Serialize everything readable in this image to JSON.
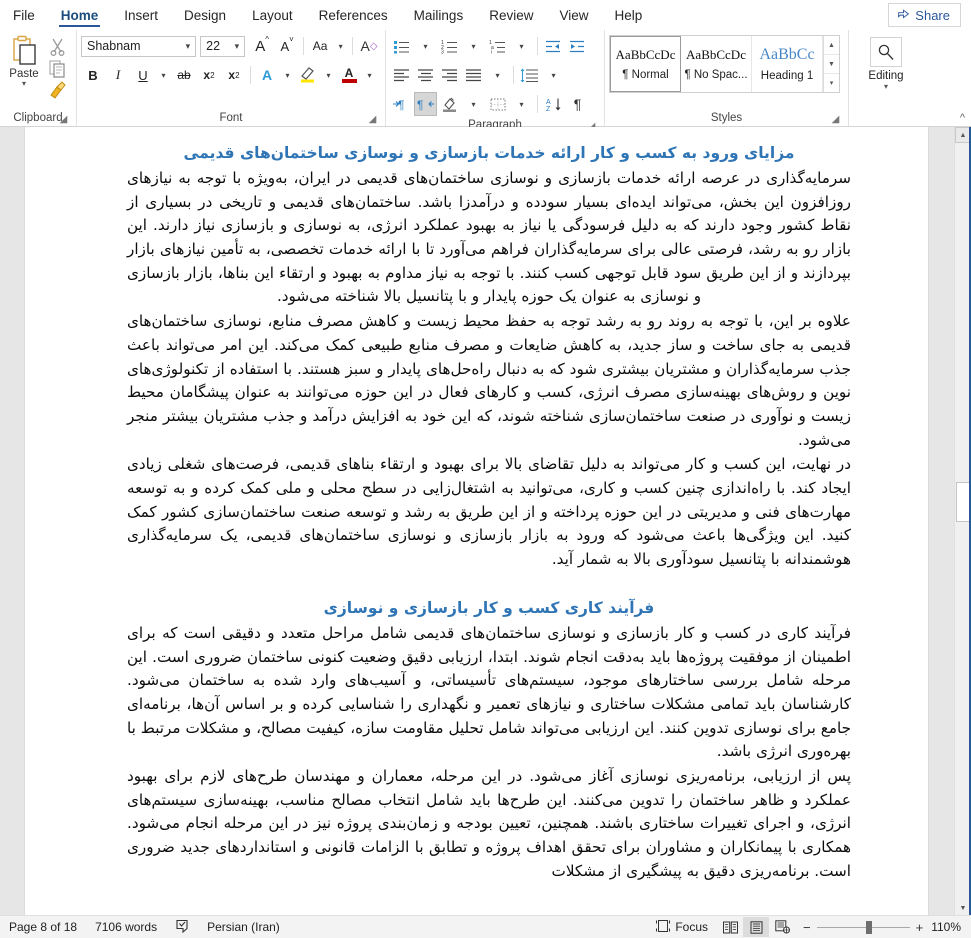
{
  "app": {
    "tabs": [
      {
        "label": "File",
        "active": false
      },
      {
        "label": "Home",
        "active": true
      },
      {
        "label": "Insert",
        "active": false
      },
      {
        "label": "Design",
        "active": false
      },
      {
        "label": "Layout",
        "active": false
      },
      {
        "label": "References",
        "active": false
      },
      {
        "label": "Mailings",
        "active": false
      },
      {
        "label": "Review",
        "active": false
      },
      {
        "label": "View",
        "active": false
      },
      {
        "label": "Help",
        "active": false
      }
    ],
    "share_label": "Share"
  },
  "ribbon": {
    "clipboard": {
      "group_label": "Clipboard",
      "paste_label": "Paste",
      "cut_name": "cut-icon",
      "copy_name": "copy-icon",
      "format_painter_name": "format-painter-icon"
    },
    "font": {
      "group_label": "Font",
      "font_name": "Shabnam",
      "font_size": "22",
      "grow_font": "A",
      "shrink_font": "A",
      "change_case": "Aa",
      "clear_formatting": "A",
      "bold": "B",
      "italic": "I",
      "underline": "U",
      "strikethrough": "ab",
      "subscript": "x",
      "superscript": "x",
      "text_effects": "A",
      "highlight": "A",
      "font_color": "A"
    },
    "paragraph": {
      "group_label": "Paragraph",
      "bullets": "bullets-icon",
      "numbering": "numbering-icon",
      "multilevel": "multilevel-list-icon",
      "decrease_indent": "decrease-indent-icon",
      "increase_indent": "increase-indent-icon",
      "align_left": "align-left-icon",
      "align_center": "align-center-icon",
      "align_right": "align-right-icon",
      "justify": "justify-icon",
      "line_spacing": "line-spacing-icon",
      "ltr": "left-to-right-icon",
      "rtl": "right-to-left-icon",
      "shading": "shading-icon",
      "borders": "borders-icon",
      "sort": "sort-icon",
      "show_marks": "show-formatting-marks-icon"
    },
    "styles": {
      "group_label": "Styles",
      "items": [
        {
          "preview": "AaBbCcDc",
          "name": "¶ Normal",
          "selected": true
        },
        {
          "preview": "AaBbCcDc",
          "name": "¶ No Spac...",
          "selected": false
        },
        {
          "preview": "AaBbCс",
          "name": "Heading 1",
          "selected": false
        }
      ]
    },
    "editing": {
      "group_label": "",
      "label": "Editing",
      "icon": "search-icon"
    }
  },
  "document": {
    "blocks": [
      {
        "type": "heading",
        "text": "مزایای ورود به کسب و کار ارائه خدمات بازسازی و نوسازی ساختمان‌های قدیمی"
      },
      {
        "type": "paragraph",
        "text": "سرمایه‌گذاری در عرصه ارائه خدمات بازسازی و نوسازی ساختمان‌های قدیمی در ایران، به‌ویژه با توجه به نیازهای روزافزون این بخش، می‌تواند ایده‌ای بسیار سودده و درآمدزا باشد. ساختمان‌های قدیمی و تاریخی در بسیاری از نقاط کشور وجود دارند که به دلیل فرسودگی یا نیاز به بهبود عملکرد انرژی، به نوسازی و بازسازی نیاز دارند. این بازار رو به رشد، فرصتی عالی برای سرمایه‌گذاران فراهم می‌آورد تا با ارائه خدمات تخصصی، به تأمین نیازهای بازار بپردازند و از این طریق سود قابل توجهی کسب کنند. با توجه به نیاز مداوم به بهبود و ارتقاء این بناها، بازار بازسازی و نوسازی به عنوان یک حوزه پایدار و با پتانسیل بالا شناخته می‌شود."
      },
      {
        "type": "paragraph",
        "text": "علاوه بر این، با توجه به روند رو به رشد توجه به حفظ محیط زیست و کاهش مصرف منابع، نوسازی ساختمان‌های قدیمی به جای ساخت و ساز جدید، به کاهش ضایعات و مصرف منابع طبیعی کمک می‌کند. این امر می‌تواند باعث جذب سرمایه‌گذاران و مشتریان بیشتری شود که به دنبال راه‌حل‌های پایدار و سبز هستند. با استفاده از تکنولوژی‌های نوین و روش‌های بهینه‌سازی مصرف انرژی، کسب و کارهای فعال در این حوزه می‌توانند به عنوان پیشگامان محیط زیست و نوآوری در صنعت ساختمان‌سازی شناخته شوند، که این خود به افزایش درآمد و جذب مشتریان بیشتر منجر می‌شود."
      },
      {
        "type": "paragraph",
        "text": "در نهایت، این کسب و کار می‌تواند به دلیل تقاضای بالا برای بهبود و ارتقاء بناهای قدیمی، فرصت‌های شغلی زیادی ایجاد کند. با راه‌اندازی چنین کسب و کاری، می‌توانید به اشتغال‌زایی در سطح محلی و ملی کمک کرده و به توسعه مهارت‌های فنی و مدیریتی در این حوزه پرداخته و از این طریق به رشد و توسعه صنعت ساختمان‌سازی کشور کمک کنید. این ویژگی‌ها باعث می‌شود که ورود به بازار بازسازی و نوسازی ساختمان‌های قدیمی، یک سرمایه‌گذاری هوشمندانه با پتانسیل سودآوری بالا به شمار آید."
      },
      {
        "type": "heading2",
        "text": "فرآیند کاری کسب و کار بازسازی و نوسازی"
      },
      {
        "type": "paragraph",
        "text": "فرآیند کاری در کسب و کار بازسازی و نوسازی ساختمان‌های قدیمی شامل مراحل متعدد و دقیقی است که برای اطمینان از موفقیت پروژه‌ها باید به‌دقت انجام شوند. ابتدا، ارزیابی دقیق وضعیت کنونی ساختمان ضروری است. این مرحله شامل بررسی ساختارهای موجود، سیستم‌های تأسیساتی، و آسیب‌های وارد شده به ساختمان می‌شود. کارشناسان باید تمامی مشکلات ساختاری و نیازهای تعمیر و نگهداری را شناسایی کرده و بر اساس آن‌ها، برنامه‌ای جامع برای نوسازی تدوین کنند. این ارزیابی می‌تواند شامل تحلیل مقاومت سازه، کیفیت مصالح، و مشکلات مرتبط با بهره‌وری انرژی باشد."
      },
      {
        "type": "paragraph",
        "text": "پس از ارزیابی، برنامه‌ریزی نوسازی آغاز می‌شود. در این مرحله، معماران و مهندسان طرح‌های لازم برای بهبود عملکرد و ظاهر ساختمان را تدوین می‌کنند. این طرح‌ها باید شامل انتخاب مصالح مناسب، بهینه‌سازی سیستم‌های انرژی، و اجرای تغییرات ساختاری باشند. همچنین، تعیین بودجه و زمان‌بندی پروژه نیز در این مرحله انجام می‌شود. همکاری با پیمانکاران و مشاوران برای تحقق اهداف پروژه و تطابق با الزامات قانونی و استانداردهای جدید ضروری است. برنامه‌ریزی دقیق به پیشگیری از مشکلات"
      }
    ]
  },
  "statusbar": {
    "page": "Page 8 of 18",
    "words": "7106 words",
    "proofing_icon": "proofing-errors-icon",
    "language": "Persian (Iran)",
    "focus_label": "Focus",
    "view_read": "read-mode-icon",
    "view_print": "print-layout-icon",
    "view_web": "web-layout-icon",
    "zoom_out": "−",
    "zoom_in": "+",
    "zoom_level": "110%"
  }
}
